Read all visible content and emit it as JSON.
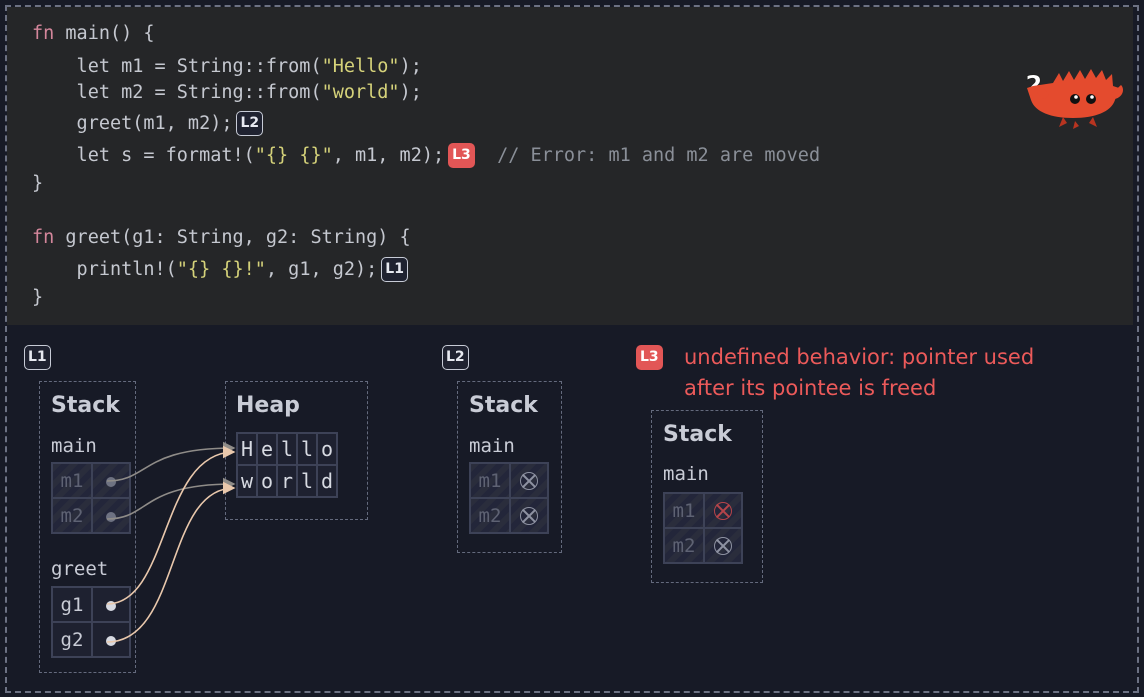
{
  "code": {
    "lines": [
      {
        "kw": "fn",
        "rest": " main() {"
      },
      {
        "p1": "    let m1 = String::from(",
        "str": "\"Hello\"",
        "p2": ");"
      },
      {
        "p1": "    let m2 = String::from(",
        "str": "\"world\"",
        "p2": ");"
      },
      {
        "p1": "    greet(m1, m2);",
        "badge": "L2"
      },
      {
        "p1": "    let s = format!(",
        "str": "\"{} {}\"",
        "p2": ", m1, m2);",
        "badge": "L3",
        "comment": "// Error: m1 and m2 are moved"
      },
      {
        "p1": "}"
      },
      {
        "kw": "fn",
        "rest": " greet(g1: String, g2: String) {"
      },
      {
        "p1": "    println!(",
        "str": "\"{} {}!\"",
        "p2": ", g1, g2);",
        "badge": "L1"
      },
      {
        "p1": "}"
      }
    ]
  },
  "mascot": {
    "glyph": "?",
    "icon": "ferris-crab-icon",
    "color": "#e44b2e"
  },
  "panels": {
    "l1": {
      "label": "L1",
      "stack_title": "Stack",
      "heap_title": "Heap",
      "main_frame": "main",
      "main_vars": [
        "m1",
        "m2"
      ],
      "greet_frame": "greet",
      "greet_vars": [
        "g1",
        "g2"
      ],
      "heap_strings": [
        "Hello",
        "world"
      ]
    },
    "l2": {
      "label": "L2",
      "stack_title": "Stack",
      "main_frame": "main",
      "main_vars": [
        "m1",
        "m2"
      ]
    },
    "l3": {
      "label": "L3",
      "message_line1": "undefined behavior: pointer used",
      "message_line2": "after its pointee is freed",
      "stack_title": "Stack",
      "main_frame": "main",
      "main_vars": [
        "m1",
        "m2"
      ]
    }
  },
  "colors": {
    "error": "#e25656",
    "arrow_moved": "#8f8c88",
    "arrow_live": "#e9c8ac"
  }
}
